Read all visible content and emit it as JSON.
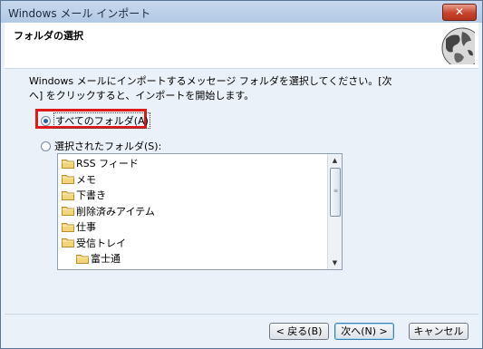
{
  "window": {
    "title": "Windows メール インポート",
    "close_symbol": "✕"
  },
  "header": {
    "title": "フォルダの選択",
    "icon": "globe-icon"
  },
  "description": "Windows メールにインポートするメッセージ フォルダを選択してください。[次へ] をクリックすると、インポートを開始します。",
  "options": {
    "all_folders": {
      "label": "すべてのフォルダ(A)",
      "selected": true
    },
    "selected_folders": {
      "label": "選択されたフォルダ(S):",
      "selected": false
    }
  },
  "folders": [
    {
      "label": "RSS フィード",
      "level": 0
    },
    {
      "label": "メモ",
      "level": 0
    },
    {
      "label": "下書き",
      "level": 0
    },
    {
      "label": "削除済みアイテム",
      "level": 0
    },
    {
      "label": "仕事",
      "level": 0
    },
    {
      "label": "受信トレイ",
      "level": 0
    },
    {
      "label": "富士通",
      "level": 1
    }
  ],
  "buttons": {
    "back": "< 戻る(B)",
    "next": "次へ(N) >",
    "cancel": "キャンセル"
  },
  "colors": {
    "highlight_border": "#e01919",
    "radio_dot": "#2d5fa8"
  }
}
